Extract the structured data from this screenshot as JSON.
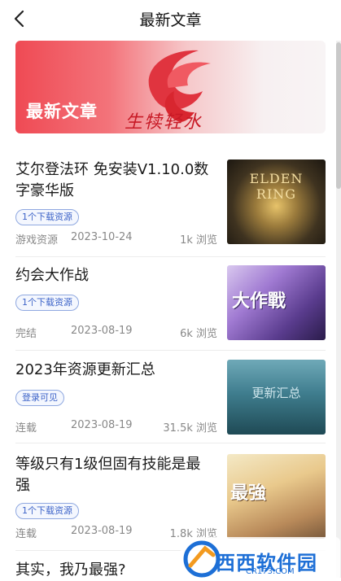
{
  "header": {
    "title": "最新文章",
    "back_icon": "chevron-left-icon"
  },
  "banner": {
    "title": "最新文章",
    "calligraphy": "生犊轻水"
  },
  "articles": [
    {
      "title": "艾尔登法环 免安装V1.10.0数字豪华版",
      "tag": "1个下载资源",
      "category": "游戏资源",
      "date": "2023-10-24",
      "views": "1k 浏览",
      "thumb_text": "ELDEN RING"
    },
    {
      "title": "约会大作战",
      "tag": "1个下载资源",
      "category": "完结",
      "date": "2023-08-19",
      "views": "6k 浏览",
      "thumb_text": "大作戰"
    },
    {
      "title": "2023年资源更新汇总",
      "tag": "登录可见",
      "category": "连载",
      "date": "2023-08-19",
      "views": "31.5k 浏览",
      "thumb_text": "更新汇总"
    },
    {
      "title": "等级只有1级但固有技能是最强",
      "tag": "1个下载资源",
      "category": "连载",
      "date": "2023-08-19",
      "views": "1.8k 浏览",
      "thumb_text": "最強"
    },
    {
      "title": "其实，我乃最强?"
    }
  ],
  "watermark": {
    "text": "西西软件园",
    "sub": "CR173.COM"
  }
}
